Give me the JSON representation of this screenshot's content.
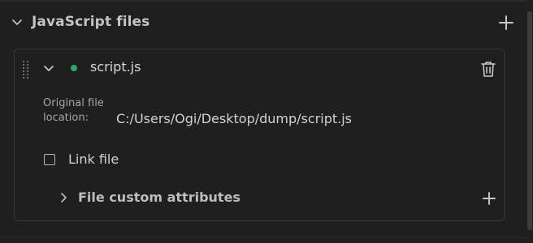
{
  "section": {
    "title": "JavaScript files",
    "chevron_icon": "chevron-down-icon",
    "add_icon": "plus-icon"
  },
  "file": {
    "name": "script.js",
    "status_color": "#2ea86c",
    "drag_icon": "drag-handle-icon",
    "delete_icon": "trash-icon",
    "location_label": "Original file location:",
    "location_value": "C:/Users/Ogi/Desktop/dump/script.js",
    "link_label": "Link file",
    "link_checked": false,
    "attributes_title": "File custom attributes",
    "attributes_chevron_icon": "chevron-right-icon",
    "attributes_add_icon": "plus-icon"
  }
}
